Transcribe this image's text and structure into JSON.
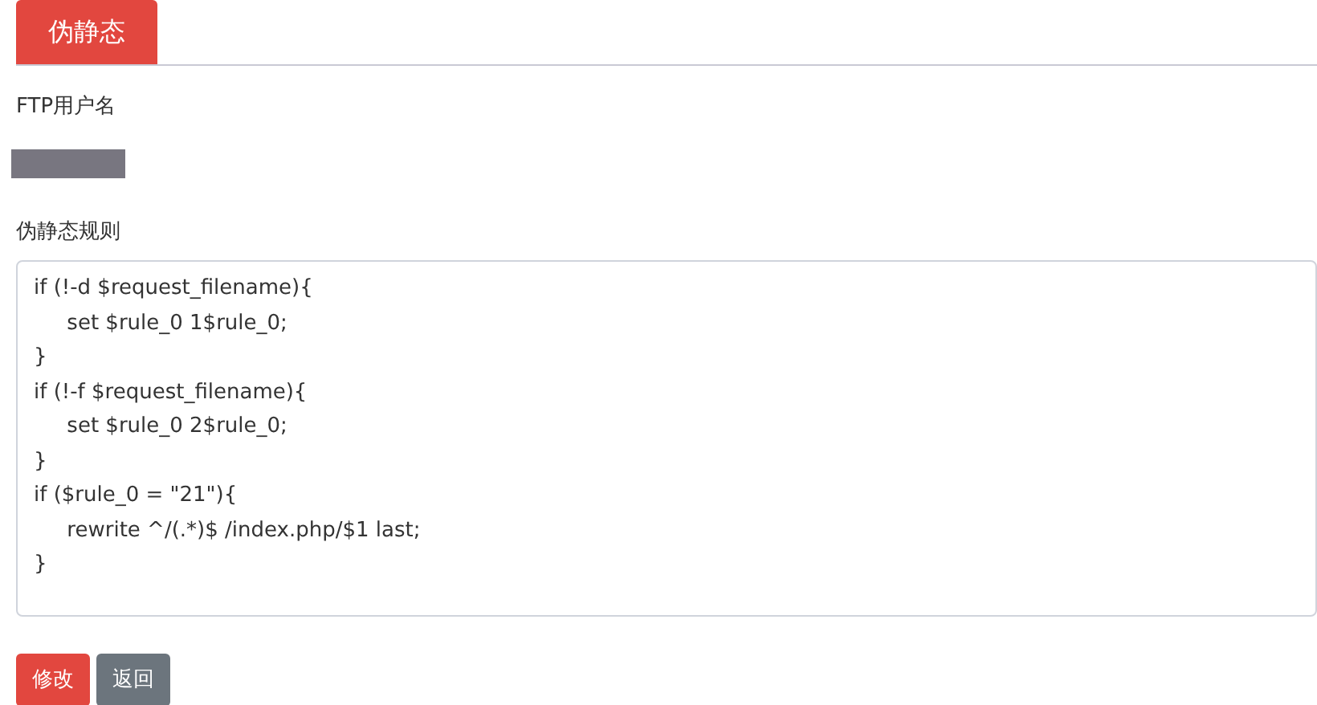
{
  "tabs": [
    {
      "label": "伪静态",
      "selected": true
    }
  ],
  "fields": [
    {
      "label": "FTP用户名",
      "kind": "redacted"
    },
    {
      "label": "伪静态规则",
      "kind": "textarea",
      "value": [
        "if (!-d $request_filename){",
        "\tset $rule_0 1$rule_0;",
        "}",
        "if (!-f $request_filename){",
        "\tset $rule_0 2$rule_0;",
        "}",
        "if ($rule_0 = \"21\"){",
        "\trewrite ^/(.*)$ /index.php/$1 last;",
        "}"
      ]
    }
  ],
  "buttons": [
    {
      "label": "修改",
      "kind": "danger"
    },
    {
      "label": "返回",
      "kind": "secondary"
    }
  ]
}
